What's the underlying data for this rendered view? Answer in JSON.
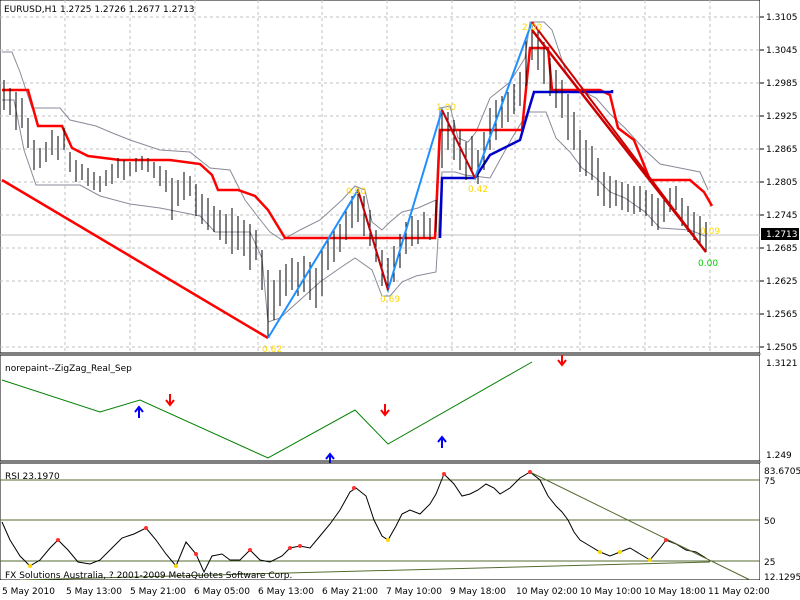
{
  "main_panel": {
    "title": "EURUSD,H1  1.2725 1.2726 1.2677 1.2713",
    "price_labels": [
      "1.3105",
      "1.3045",
      "1.2985",
      "1.2925",
      "1.2865",
      "1.2805",
      "1.2745",
      "1.2685",
      "1.2625",
      "1.2565",
      "1.2505"
    ],
    "current_price": "1.2713",
    "zigzag_labels": [
      {
        "text": "0.62"
      },
      {
        "text": "0.90"
      },
      {
        "text": "0.69"
      },
      {
        "text": "1.00"
      },
      {
        "text": "0.42"
      },
      {
        "text": "2.00"
      },
      {
        "text": "0.09"
      },
      {
        "text": "0.00"
      }
    ]
  },
  "zigzag_panel": {
    "title": "norepaint--ZigZag_Real_Sep",
    "top_value": "1.3121",
    "bottom_value": "1.249"
  },
  "rsi_panel": {
    "title": "RSI 23.1970",
    "top_value": "83.6705",
    "levels": [
      "75",
      "50",
      "25"
    ],
    "bottom_value": "12.1295",
    "copyright": "FX Solutions Australia, ? 2001-2009 MetaQuotes Software Corp."
  },
  "time_labels": [
    "5 May 2010",
    "5 May 13:00",
    "5 May 21:00",
    "6 May 05:00",
    "6 May 13:00",
    "6 May 21:00",
    "7 May 10:00",
    "9 May 18:00",
    "10 May 02:00",
    "10 May 10:00",
    "10 May 18:00",
    "11 May 02:00"
  ],
  "colors": {
    "red_line": "#ff0000",
    "dark_red": "#cc0000",
    "blue_line": "#1e90ff",
    "navy_line": "#0000cc",
    "grid": "#c0c0c0",
    "zz_line": "#008000",
    "arrow_up": "#0000ff",
    "arrow_down": "#ff0000",
    "label_yellow": "#ffd700",
    "label_green": "#00cc00"
  }
}
